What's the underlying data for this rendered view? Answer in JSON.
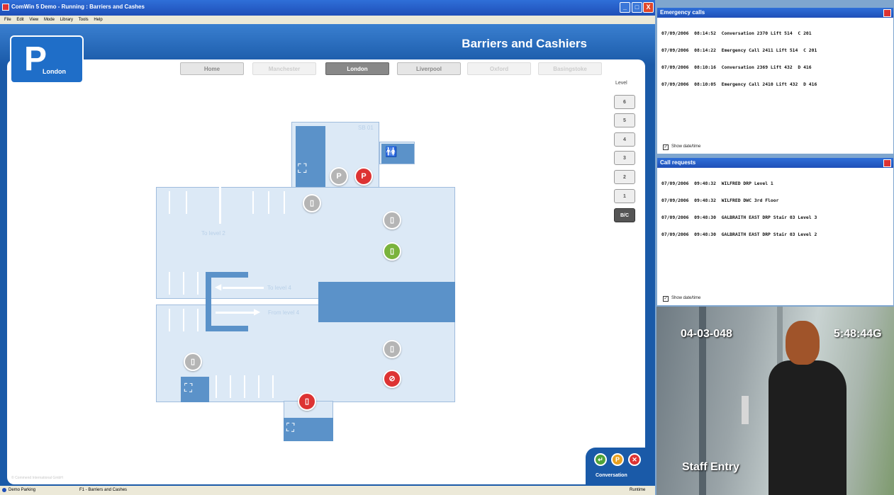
{
  "window": {
    "title": "ComWin 5 Demo - Running : Barriers and Cashes",
    "buttons": [
      "_",
      "□",
      "X"
    ]
  },
  "menu": [
    "File",
    "Edit",
    "View",
    "Mode",
    "Library",
    "Tools",
    "Help"
  ],
  "logo": {
    "letter": "P",
    "city": "London"
  },
  "page_title": "Barriers and Cashiers",
  "nav_tabs": [
    {
      "label": "Home",
      "state": "normal"
    },
    {
      "label": "Manchester",
      "state": "dim"
    },
    {
      "label": "London",
      "state": "active"
    },
    {
      "label": "Liverpool",
      "state": "normal"
    },
    {
      "label": "Oxford",
      "state": "dim"
    },
    {
      "label": "Basingstoke",
      "state": "dim"
    }
  ],
  "levels": {
    "label": "Level",
    "items": [
      "6",
      "5",
      "4",
      "3",
      "2",
      "1",
      "B/C"
    ],
    "active": "B/C"
  },
  "floorplan": {
    "area_code": "SB 01",
    "to_level_2": "To level 2",
    "to_level_4": "To level 4",
    "from_level_4": "From level 4"
  },
  "footer_copyright": "© Commend International GmbH",
  "conversation": {
    "label": "Conversation",
    "accept_icon": "↵",
    "park_icon": "P",
    "close_icon": "✕"
  },
  "statusbar": {
    "site": "Demo Parking",
    "page": "F1 - Barriers and Cashes",
    "mode": "Runtime"
  },
  "emergency_calls": {
    "title": "Emergency calls",
    "lines": [
      "07/09/2006  08:14:52  Conversation 2370 Lift 514  C 201",
      "07/09/2006  08:14:22  Emergency Call 2411 Lift 514  C 201",
      "07/09/2006  08:10:16  Conversation 2369 Lift 432  D 416",
      "07/09/2006  08:10:05  Emergency Call 2410 Lift 432  D 416"
    ],
    "show_datetime": "Show date/time"
  },
  "call_requests": {
    "title": "Call requests",
    "lines": [
      "07/09/2006  09:48:32  WILFRED DRP Level 1",
      "07/09/2006  09:48:32  WILFRED DWC 3rd Floor",
      "07/09/2006  09:48:30  GALBRAITH EAST DRP Stair 03 Level 3",
      "07/09/2006  09:48:30  GALBRAITH EAST DRP Stair 03 Level 2"
    ],
    "show_datetime": "Show date/time"
  },
  "video": {
    "camera_id": "04-03-048",
    "time": "5:48:44G",
    "caption": "Staff Entry"
  }
}
